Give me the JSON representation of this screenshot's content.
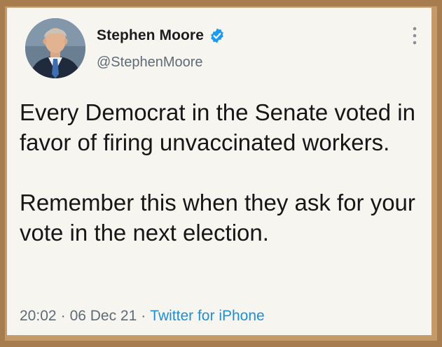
{
  "tweet": {
    "author_name": "Stephen Moore",
    "handle": "@StephenMoore",
    "verified_icon": "verified-badge-icon",
    "text_paragraph_1": "Every Democrat in the Senate voted in favor of firing unvaccinated workers.",
    "text_paragraph_2": "Remember this when they ask for your vote in the next election.",
    "time": "20:02",
    "separator": "·",
    "date": "06 Dec 21",
    "source": "Twitter for iPhone"
  },
  "colors": {
    "frame": "#a77c4f",
    "card": "#f6f5f0",
    "accent": "#1d8fd6",
    "meta_text": "#5f6b75"
  }
}
